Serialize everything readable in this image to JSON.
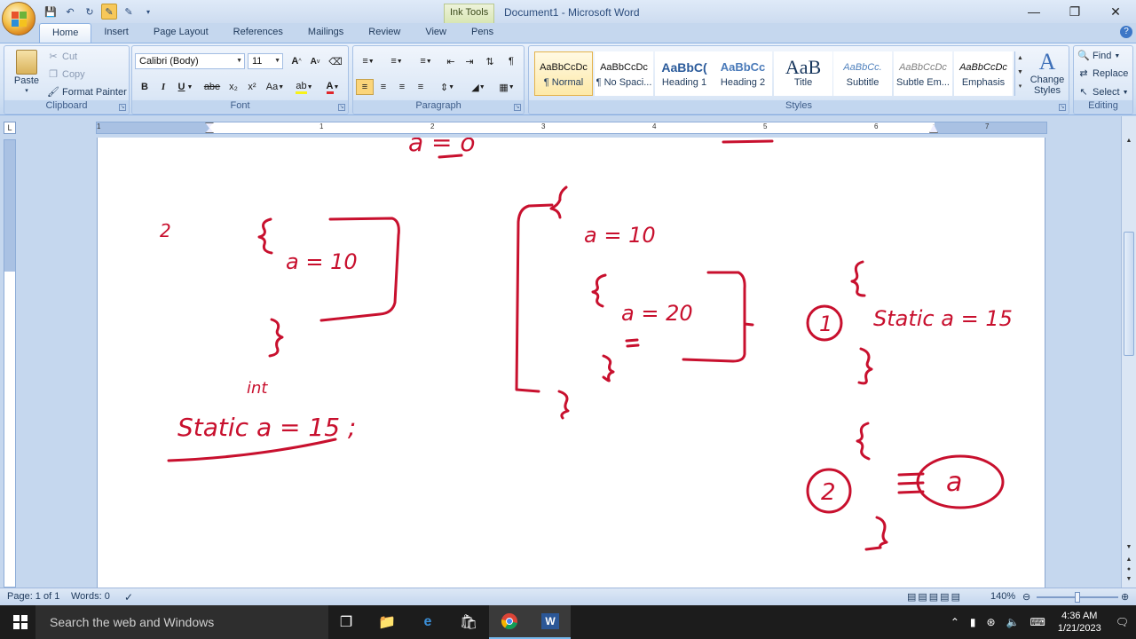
{
  "window": {
    "title": "Document1 - Microsoft Word",
    "context_tab": "Ink Tools",
    "controls": [
      "minimize",
      "restore",
      "close"
    ]
  },
  "tabs": [
    "Home",
    "Insert",
    "Page Layout",
    "References",
    "Mailings",
    "Review",
    "View",
    "Pens"
  ],
  "active_tab": "Home",
  "clipboard": {
    "paste": "Paste",
    "cut": "Cut",
    "copy": "Copy",
    "format_painter": "Format Painter",
    "label": "Clipboard"
  },
  "font": {
    "name": "Calibri (Body)",
    "size": "11",
    "label": "Font",
    "buttons": [
      "B",
      "I",
      "U",
      "abe",
      "x₂",
      "x²",
      "Aa"
    ]
  },
  "paragraph": {
    "label": "Paragraph"
  },
  "styles": {
    "label": "Styles",
    "items": [
      {
        "sample": "AaBbCcDc",
        "name": "¶ Normal"
      },
      {
        "sample": "AaBbCcDc",
        "name": "¶ No Spaci..."
      },
      {
        "sample": "AaBbC(",
        "name": "Heading 1"
      },
      {
        "sample": "AaBbCc",
        "name": "Heading 2"
      },
      {
        "sample": "AaB",
        "name": "Title"
      },
      {
        "sample": "AaBbCc.",
        "name": "Subtitle"
      },
      {
        "sample": "AaBbCcDc",
        "name": "Subtle Em..."
      },
      {
        "sample": "AaBbCcDc",
        "name": "Emphasis"
      }
    ],
    "change_styles": "Change Styles"
  },
  "editing": {
    "find": "Find",
    "replace": "Replace",
    "select": "Select",
    "label": "Editing"
  },
  "ruler": {
    "numbers": [
      "1",
      "1",
      "2",
      "3",
      "4",
      "5",
      "6",
      "7"
    ]
  },
  "ink_text": {
    "top_partial": "a = o",
    "num_2": "2",
    "block1_a": "a = 10",
    "int_label": "int",
    "static_decl": "Static a = 15 ;",
    "block2_outer": "a = 10",
    "block2_inner": "a = 20",
    "circle1": "1",
    "static_a": "Static a = 15",
    "circle2": "2",
    "circle_a": "a"
  },
  "status": {
    "page": "Page: 1 of 1",
    "words": "Words: 0",
    "zoom": "140%"
  },
  "taskbar": {
    "search_placeholder": "Search the web and Windows",
    "time": "4:36 AM",
    "date": "1/21/2023"
  },
  "colors": {
    "ink": "#c8102e",
    "ribbon": "#dbe7f6",
    "accent": "#fbd57a"
  }
}
